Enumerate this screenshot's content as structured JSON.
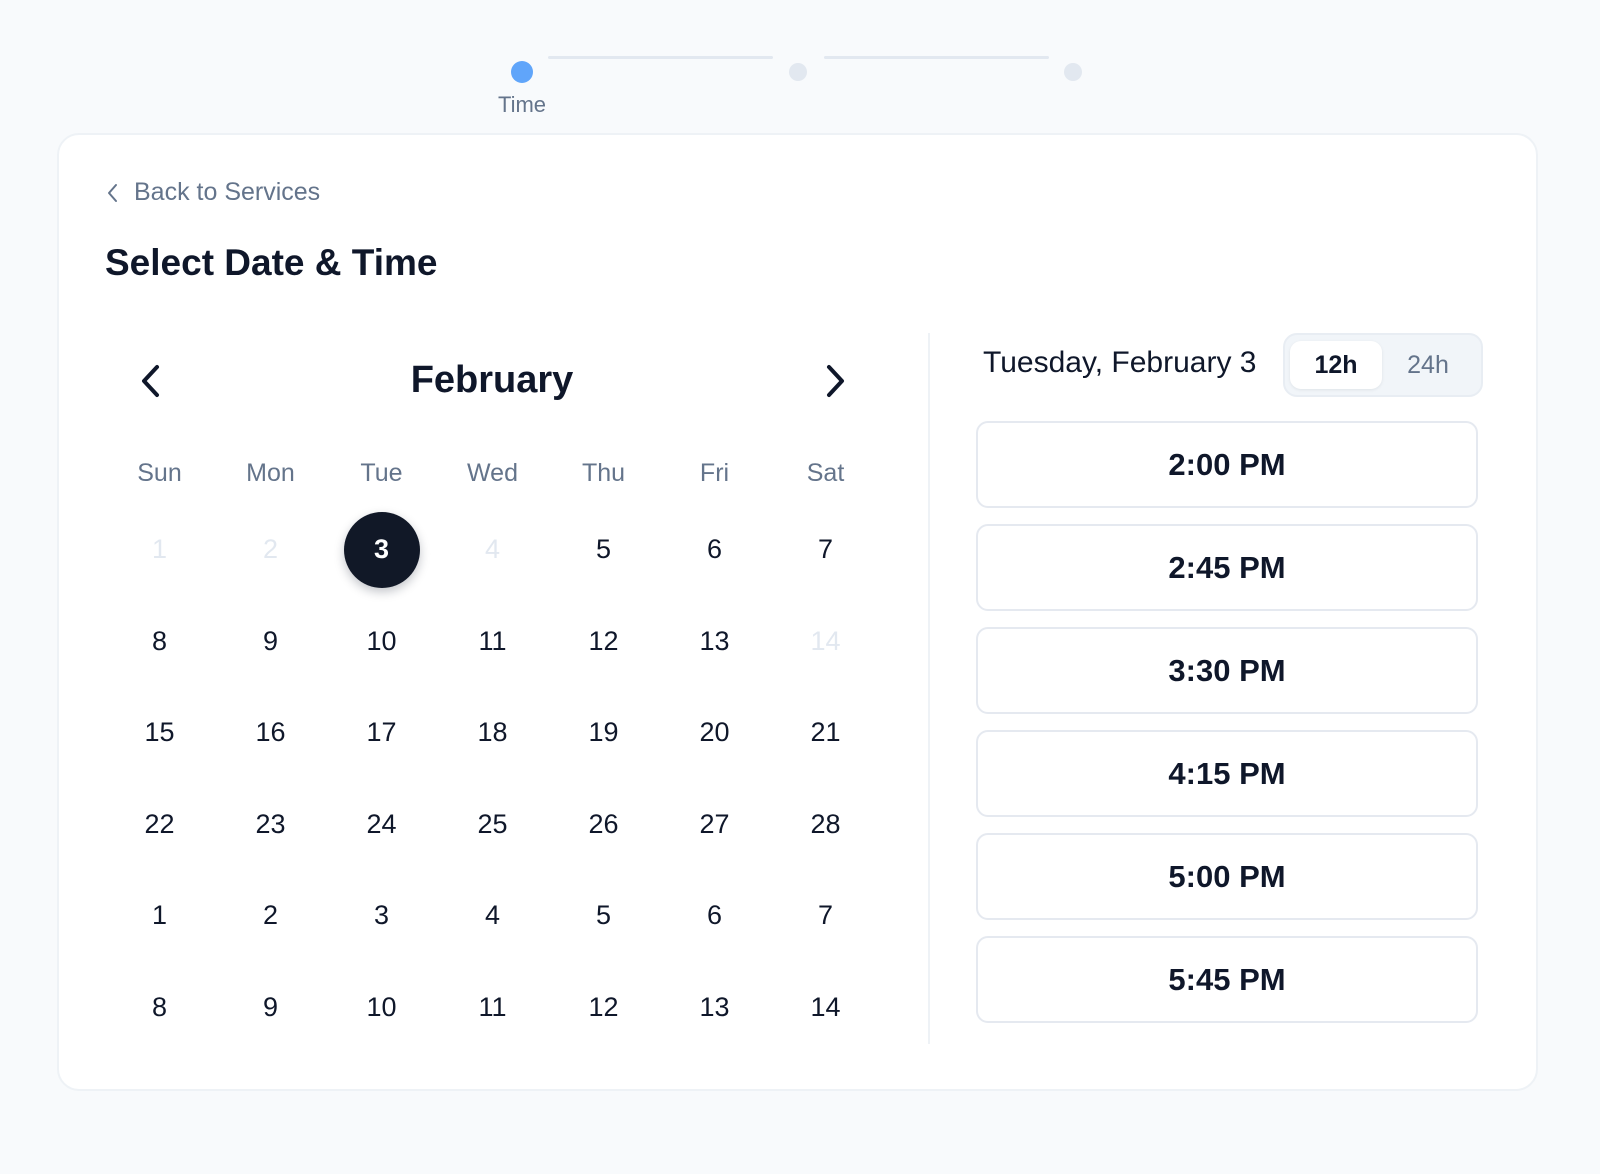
{
  "stepper": {
    "active_label": "Time"
  },
  "back_link": {
    "label": "Back to Services"
  },
  "page_title": "Select Date & Time",
  "calendar": {
    "month": "February",
    "weekdays": [
      "Sun",
      "Mon",
      "Tue",
      "Wed",
      "Thu",
      "Fri",
      "Sat"
    ],
    "days": [
      {
        "label": "1",
        "state": "disabled"
      },
      {
        "label": "2",
        "state": "disabled"
      },
      {
        "label": "3",
        "state": "selected"
      },
      {
        "label": "4",
        "state": "disabled"
      },
      {
        "label": "5",
        "state": "available"
      },
      {
        "label": "6",
        "state": "available"
      },
      {
        "label": "7",
        "state": "available"
      },
      {
        "label": "8",
        "state": "available"
      },
      {
        "label": "9",
        "state": "available"
      },
      {
        "label": "10",
        "state": "available"
      },
      {
        "label": "11",
        "state": "available"
      },
      {
        "label": "12",
        "state": "available"
      },
      {
        "label": "13",
        "state": "available"
      },
      {
        "label": "14",
        "state": "disabled"
      },
      {
        "label": "15",
        "state": "available"
      },
      {
        "label": "16",
        "state": "available"
      },
      {
        "label": "17",
        "state": "available"
      },
      {
        "label": "18",
        "state": "available"
      },
      {
        "label": "19",
        "state": "available"
      },
      {
        "label": "20",
        "state": "available"
      },
      {
        "label": "21",
        "state": "available"
      },
      {
        "label": "22",
        "state": "available"
      },
      {
        "label": "23",
        "state": "available"
      },
      {
        "label": "24",
        "state": "available"
      },
      {
        "label": "25",
        "state": "available"
      },
      {
        "label": "26",
        "state": "available"
      },
      {
        "label": "27",
        "state": "available"
      },
      {
        "label": "28",
        "state": "available"
      },
      {
        "label": "1",
        "state": "available"
      },
      {
        "label": "2",
        "state": "available"
      },
      {
        "label": "3",
        "state": "available"
      },
      {
        "label": "4",
        "state": "available"
      },
      {
        "label": "5",
        "state": "available"
      },
      {
        "label": "6",
        "state": "available"
      },
      {
        "label": "7",
        "state": "available"
      },
      {
        "label": "8",
        "state": "available"
      },
      {
        "label": "9",
        "state": "available"
      },
      {
        "label": "10",
        "state": "available"
      },
      {
        "label": "11",
        "state": "available"
      },
      {
        "label": "12",
        "state": "available"
      },
      {
        "label": "13",
        "state": "available"
      },
      {
        "label": "14",
        "state": "available"
      }
    ]
  },
  "selected_date": "Tuesday, February 3",
  "time_format": {
    "options": [
      "12h",
      "24h"
    ],
    "selected": "12h"
  },
  "time_slots": [
    "2:00 PM",
    "2:45 PM",
    "3:30 PM",
    "4:15 PM",
    "5:00 PM",
    "5:45 PM"
  ],
  "colors": {
    "accent": "#60a5fa",
    "selected_day": "#111827",
    "muted_text": "#64748b",
    "disabled_text": "#e2e8f0"
  },
  "icons": {
    "back": "chevron-left-icon",
    "prev": "chevron-left-icon",
    "next": "chevron-right-icon"
  }
}
